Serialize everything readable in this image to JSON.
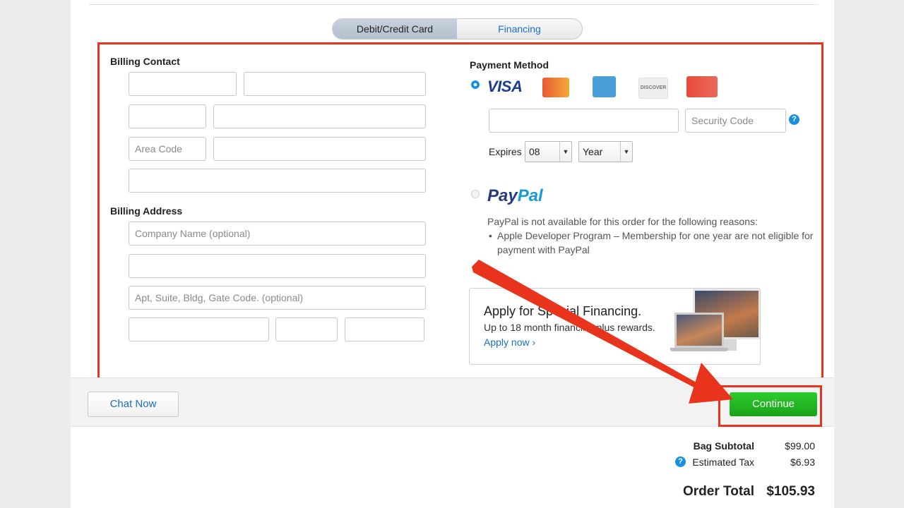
{
  "tabs": {
    "active": "Debit/Credit Card",
    "inactive": "Financing"
  },
  "billing_contact": {
    "title": "Billing Contact",
    "area_code_placeholder": "Area Code"
  },
  "billing_address": {
    "title": "Billing Address",
    "company_placeholder": "Company Name (optional)",
    "apt_placeholder": "Apt, Suite, Bldg, Gate Code. (optional)"
  },
  "payment": {
    "title": "Payment Method",
    "selected_method": "VISA",
    "cards": [
      "VISA",
      "MasterCard",
      "American Express",
      "DISCOVER",
      "UnionPay"
    ],
    "card_visa_text": "VISA",
    "card_discover_text": "DISCOVER",
    "security_code_placeholder": "Security Code",
    "help_glyph": "?",
    "expires_label": "Expires",
    "expires_month": "08",
    "expires_year": "Year"
  },
  "paypal": {
    "logo_part1": "Pay",
    "logo_part2": "Pal",
    "note_line": "PayPal is not available for this order for the following reasons:",
    "reason": "Apple Developer Program – Membership for one year are not eligible for payment with PayPal"
  },
  "promo": {
    "title": "Apply for Special Financing.",
    "subtitle": "Up to 18 month financing plus rewards.",
    "link": "Apply now ›"
  },
  "footer": {
    "chat_label": "Chat Now",
    "continue_label": "Continue"
  },
  "summary": {
    "subtotal_label": "Bag Subtotal",
    "subtotal_value": "$99.00",
    "tax_label": "Estimated Tax",
    "tax_value": "$6.93",
    "total_label": "Order Total",
    "total_value": "$105.93"
  },
  "colors": {
    "accent": "#1a8fe0",
    "highlight": "#e8341c",
    "continue": "#1fb41f"
  }
}
